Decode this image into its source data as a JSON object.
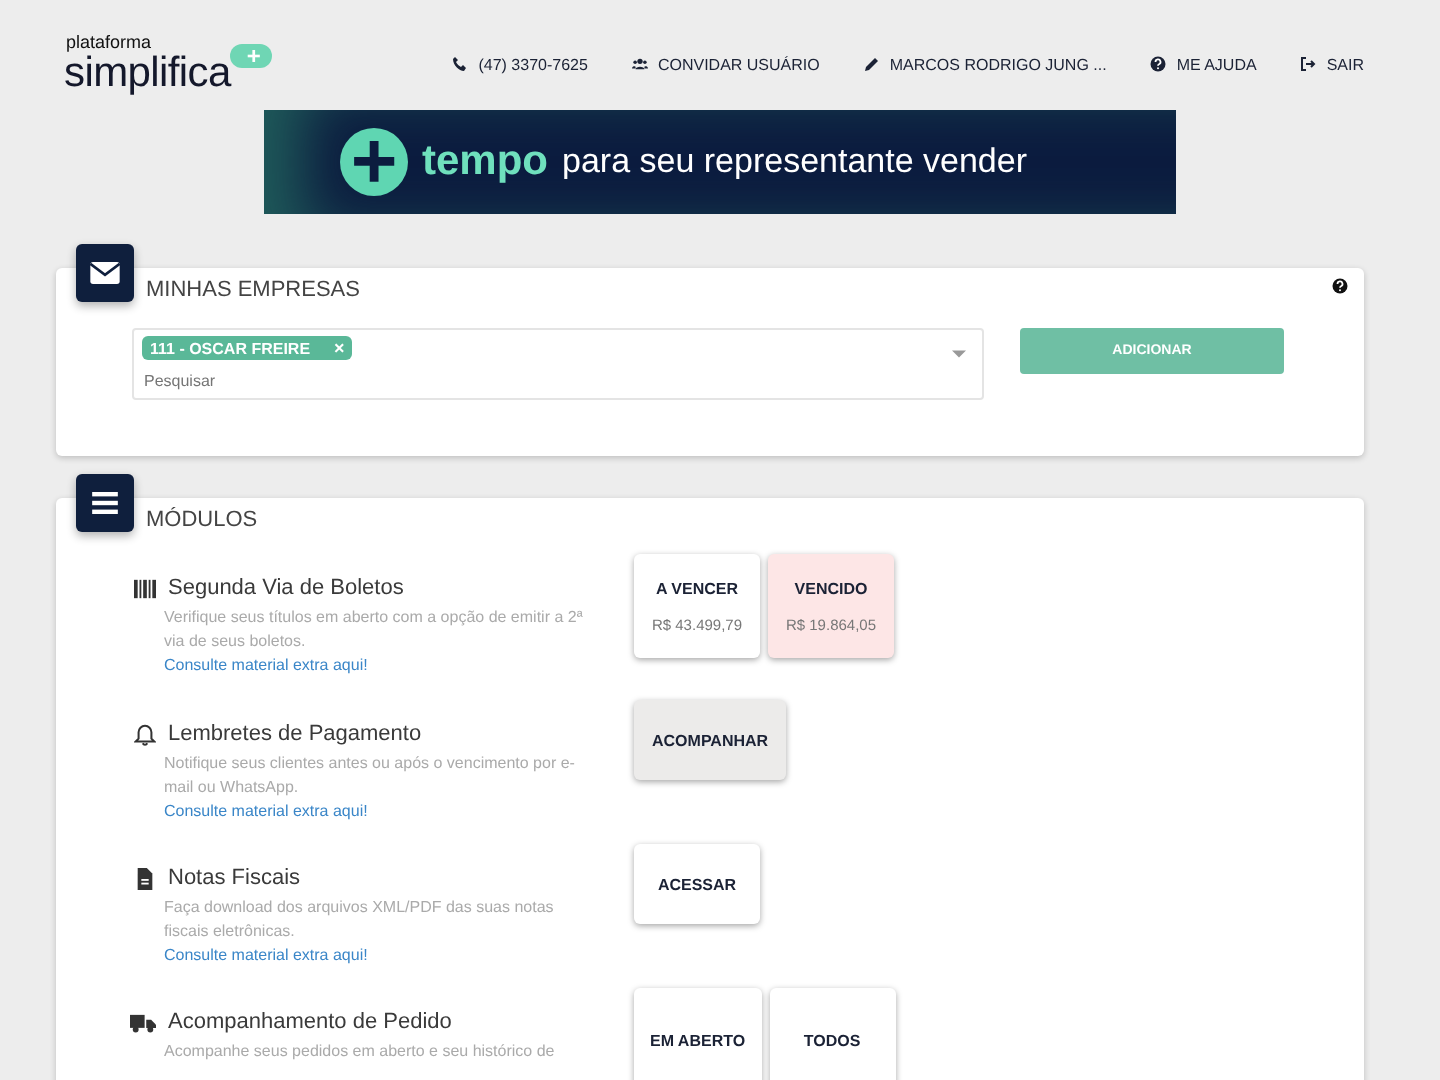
{
  "logo": {
    "small": "plataforma",
    "big": "simplifica",
    "badge": "+"
  },
  "nav": [
    {
      "label": "(47) 3370-7625"
    },
    {
      "label": "CONVIDAR USUÁRIO"
    },
    {
      "label": "MARCOS RODRIGO JUNG ..."
    },
    {
      "label": "ME AJUDA"
    },
    {
      "label": "SAIR"
    }
  ],
  "banner": {
    "plus": "+",
    "highlight": "tempo",
    "text": "para seu representante vender"
  },
  "companies": {
    "title": "MINHAS EMPRESAS",
    "tags": [
      {
        "label": "111 - OSCAR FREIRE",
        "remove": "×"
      }
    ],
    "placeholder": "Pesquisar",
    "add_button": "ADICIONAR"
  },
  "modules": {
    "title": "MÓDULOS",
    "items": [
      {
        "title": "Segunda Via de Boletos",
        "description": "Verifique seus títulos em aberto com a opção de emitir a 2ª via de seus boletos.",
        "link": "Consulte material extra aqui!",
        "buttons": [
          {
            "kind": "plain",
            "label": "A VENCER",
            "value": "R$ 43.499,79"
          },
          {
            "kind": "danger",
            "label": "VENCIDO",
            "value": "R$ 19.864,05"
          }
        ]
      },
      {
        "title": "Lembretes de Pagamento",
        "description": "Notifique seus clientes antes ou após o vencimento por e-mail ou WhatsApp.",
        "link": "Consulte material extra aqui!",
        "buttons": [
          {
            "kind": "muted",
            "label": "ACOMPANHAR"
          }
        ]
      },
      {
        "title": "Notas Fiscais",
        "description": "Faça download dos arquivos XML/PDF das suas notas fiscais eletrônicas.",
        "link": "Consulte material extra aqui!",
        "buttons": [
          {
            "kind": "plain",
            "label": "ACESSAR"
          }
        ]
      },
      {
        "title": "Acompanhamento de Pedido",
        "description": "Acompanhe seus pedidos em aberto e seu histórico de",
        "buttons": [
          {
            "kind": "plain",
            "label": "EM ABERTO"
          },
          {
            "kind": "plain",
            "label": "TODOS"
          }
        ]
      }
    ]
  }
}
